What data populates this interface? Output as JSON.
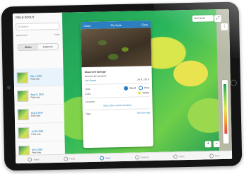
{
  "sidebar": {
    "title": "FIELD SCOUT",
    "search_placeholder": "Q Search",
    "meta_left": "Season Nov",
    "meta_right": "Fields",
    "tabs": [
      {
        "label": "Notes",
        "active": true
      },
      {
        "label": "Captures",
        "active": false
      }
    ],
    "items": [
      {
        "date": "Sep 7, 2019",
        "line2": "Field note"
      },
      {
        "date": "Aug 21, 2019",
        "line2": "Field note"
      },
      {
        "date": "Aug 3, 2019",
        "line2": "Field note"
      },
      {
        "date": "Jul 20, 2019",
        "line2": "Field note"
      },
      {
        "date": "Jul 4, 2019",
        "line2": "Field note"
      }
    ]
  },
  "map": {
    "layer_label": "Field Health",
    "zoom_in": "+",
    "zoom_out": "−"
  },
  "card": {
    "header_left": "Close",
    "header_title": "Pin Note",
    "header_right": "Save",
    "section_title": "Observed damage",
    "need_label": "Need to be sprayed",
    "author_label": "Jon Brown",
    "author_date": "Jul 8, 2019",
    "type_label": "Type",
    "type_options": [
      "Weed",
      "Pest"
    ],
    "color_label": "Color",
    "color_value": "Yellow",
    "location_label": "Location",
    "location_action": "Set to the current location",
    "tags_label": "Tags",
    "tags_action": "Choose tag"
  },
  "bottom_nav": [
    {
      "label": "Notes",
      "active": false
    },
    {
      "label": "Fields",
      "active": false
    },
    {
      "label": "Maps",
      "active": true
    },
    {
      "label": "Weather",
      "active": false
    },
    {
      "label": "Alerts",
      "active": false
    },
    {
      "label": "More",
      "active": false
    }
  ],
  "colors": {
    "accent": "#2b7fc1",
    "healthy": "#1f9a56",
    "stress": "#e6e34f",
    "critical": "#e34040"
  }
}
